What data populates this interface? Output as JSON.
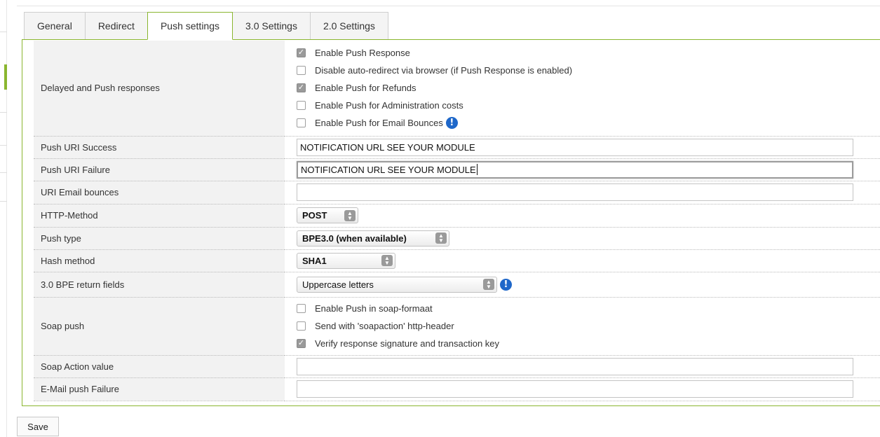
{
  "tabs": [
    {
      "label": "General"
    },
    {
      "label": "Redirect"
    },
    {
      "label": "Push settings"
    },
    {
      "label": "3.0 Settings"
    },
    {
      "label": "2.0 Settings"
    }
  ],
  "delayed": {
    "label": "Delayed and Push responses",
    "options": [
      {
        "label": "Enable Push Response",
        "checked": true
      },
      {
        "label": "Disable auto-redirect via browser (if Push Response is enabled)",
        "checked": false
      },
      {
        "label": "Enable Push for Refunds",
        "checked": true
      },
      {
        "label": "Enable Push for Administration costs",
        "checked": false
      },
      {
        "label": "Enable Push for Email Bounces",
        "checked": false
      }
    ]
  },
  "push_uri_success": {
    "label": "Push URI Success",
    "value": "NOTIFICATION URL SEE YOUR MODULE"
  },
  "push_uri_failure": {
    "label": "Push URI Failure",
    "value": "NOTIFICATION URL SEE YOUR MODULE"
  },
  "uri_email_bounces": {
    "label": "URI Email bounces",
    "value": ""
  },
  "http_method": {
    "label": "HTTP-Method",
    "value": "POST"
  },
  "push_type": {
    "label": "Push type",
    "value": "BPE3.0 (when available)"
  },
  "hash_method": {
    "label": "Hash method",
    "value": "SHA1"
  },
  "bpe_return_fields": {
    "label": "3.0 BPE return fields",
    "value": "Uppercase letters"
  },
  "soap_push": {
    "label": "Soap push",
    "options": [
      {
        "label": "Enable Push in soap-formaat",
        "checked": false
      },
      {
        "label": "Send with 'soapaction' http-header",
        "checked": false
      },
      {
        "label": "Verify response signature and transaction key",
        "checked": true
      }
    ]
  },
  "soap_action_value": {
    "label": "Soap Action value",
    "value": ""
  },
  "email_push_failure": {
    "label": "E-Mail push Failure",
    "value": ""
  },
  "save_label": "Save",
  "icons": {
    "info": "info-icon",
    "select": "select-arrows-icon",
    "check": "checkmark-icon"
  },
  "colors": {
    "accent": "#8ab62f",
    "info": "#1e67c9",
    "label_bg": "#f2f2f2"
  }
}
